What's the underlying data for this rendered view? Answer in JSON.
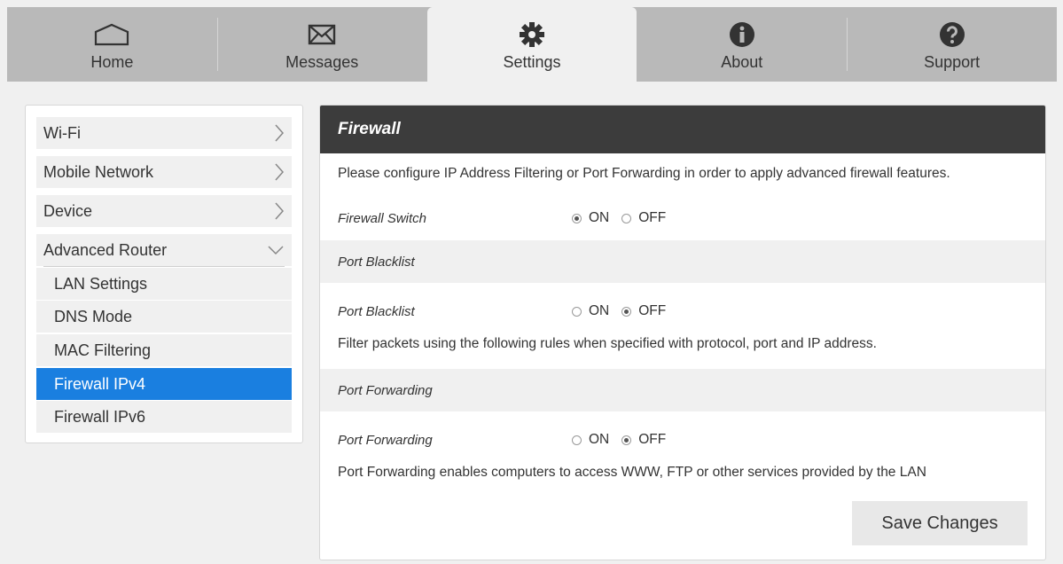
{
  "nav": {
    "tabs": [
      {
        "label": "Home",
        "icon": "home-icon"
      },
      {
        "label": "Messages",
        "icon": "envelope-icon"
      },
      {
        "label": "Settings",
        "icon": "gear-icon"
      },
      {
        "label": "About",
        "icon": "info-icon"
      },
      {
        "label": "Support",
        "icon": "question-icon"
      }
    ],
    "active": "Settings"
  },
  "sidebar": {
    "items": [
      {
        "label": "Wi-Fi"
      },
      {
        "label": "Mobile Network"
      },
      {
        "label": "Device"
      },
      {
        "label": "Advanced Router"
      }
    ],
    "subitems": [
      {
        "label": "LAN Settings"
      },
      {
        "label": "DNS Mode"
      },
      {
        "label": "MAC Filtering"
      },
      {
        "label": "Firewall IPv4"
      },
      {
        "label": "Firewall IPv6"
      }
    ],
    "active_subitem": "Firewall IPv4"
  },
  "panel": {
    "title": "Firewall",
    "intro": "Please configure IP Address Filtering or Port Forwarding in order to apply advanced firewall features.",
    "firewall_switch": {
      "label": "Firewall Switch",
      "on": "ON",
      "off": "OFF",
      "value": "ON"
    },
    "port_blacklist_section": "Port Blacklist",
    "port_blacklist": {
      "label": "Port Blacklist",
      "on": "ON",
      "off": "OFF",
      "value": "OFF"
    },
    "blacklist_desc": "Filter packets using the following rules when specified with protocol, port and IP address.",
    "port_forwarding_section": "Port Forwarding",
    "port_forwarding": {
      "label": "Port Forwarding",
      "on": "ON",
      "off": "OFF",
      "value": "OFF"
    },
    "forwarding_desc": "Port Forwarding enables computers to access WWW, FTP or other services provided by the LAN",
    "save_label": "Save Changes"
  },
  "colors": {
    "accent": "#1a7fe0",
    "header": "#3c3c3c",
    "nav_bg": "#b9b9b9"
  }
}
